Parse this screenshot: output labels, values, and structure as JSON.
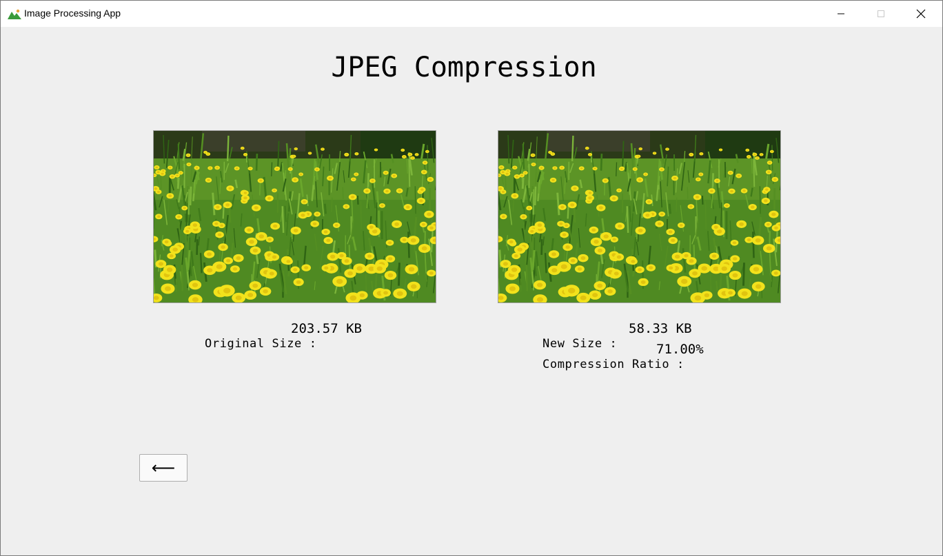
{
  "window": {
    "title": "Image Processing App",
    "icon": "landscape-icon",
    "controls": [
      "minimize-icon",
      "maximize-icon",
      "close-icon"
    ]
  },
  "page": {
    "title": "JPEG Compression"
  },
  "original": {
    "size_label": "Original Size :",
    "size_value": "203.57 KB"
  },
  "compressed": {
    "size_label": "New Size :",
    "size_value": "58.33 KB",
    "ratio_label": "Compression Ratio :",
    "ratio_value": "71.00%"
  },
  "back_button": {
    "label": "⟵",
    "icon": "arrow-left-icon"
  },
  "colors": {
    "background": "#efefef",
    "titlebar": "#ffffff",
    "flower_yellow": "#f2e21c",
    "grass_green": "#4f8f1f"
  }
}
